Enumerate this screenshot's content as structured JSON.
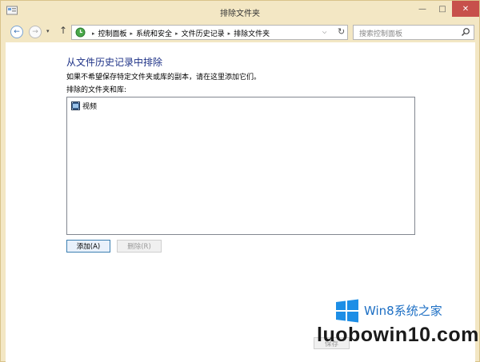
{
  "window": {
    "title": "排除文件夹",
    "minimize_glyph": "—",
    "maximize_glyph": "□",
    "close_glyph": "✕"
  },
  "nav": {
    "back_glyph": "←",
    "forward_glyph": "→",
    "recent_glyph": "▾",
    "up_glyph": "↑"
  },
  "address": {
    "crumbs": [
      "控制面板",
      "系统和安全",
      "文件历史记录",
      "排除文件夹"
    ],
    "separator": "▸",
    "dropdown_glyph": "⌵",
    "refresh_glyph": "↻",
    "icon": "control-panel-icon"
  },
  "search": {
    "placeholder": "搜索控制面板",
    "icon": "search-icon"
  },
  "main": {
    "heading": "从文件历史记录中排除",
    "description": "如果不希望保存特定文件夹或库的副本，请在这里添加它们。",
    "list_label": "排除的文件夹和库:",
    "items": [
      {
        "label": "视频",
        "icon": "video-library-icon"
      }
    ],
    "add_label": "添加(A)",
    "remove_label": "删除(R)",
    "save_label": "保存"
  },
  "watermark": {
    "brand": "Win8系统之家",
    "domain": "luobowin10.com"
  },
  "colors": {
    "frame": "#f3e7c4",
    "heading": "#1e3287",
    "close": "#c7504b",
    "watermark_blue": "#1d6fc4"
  }
}
